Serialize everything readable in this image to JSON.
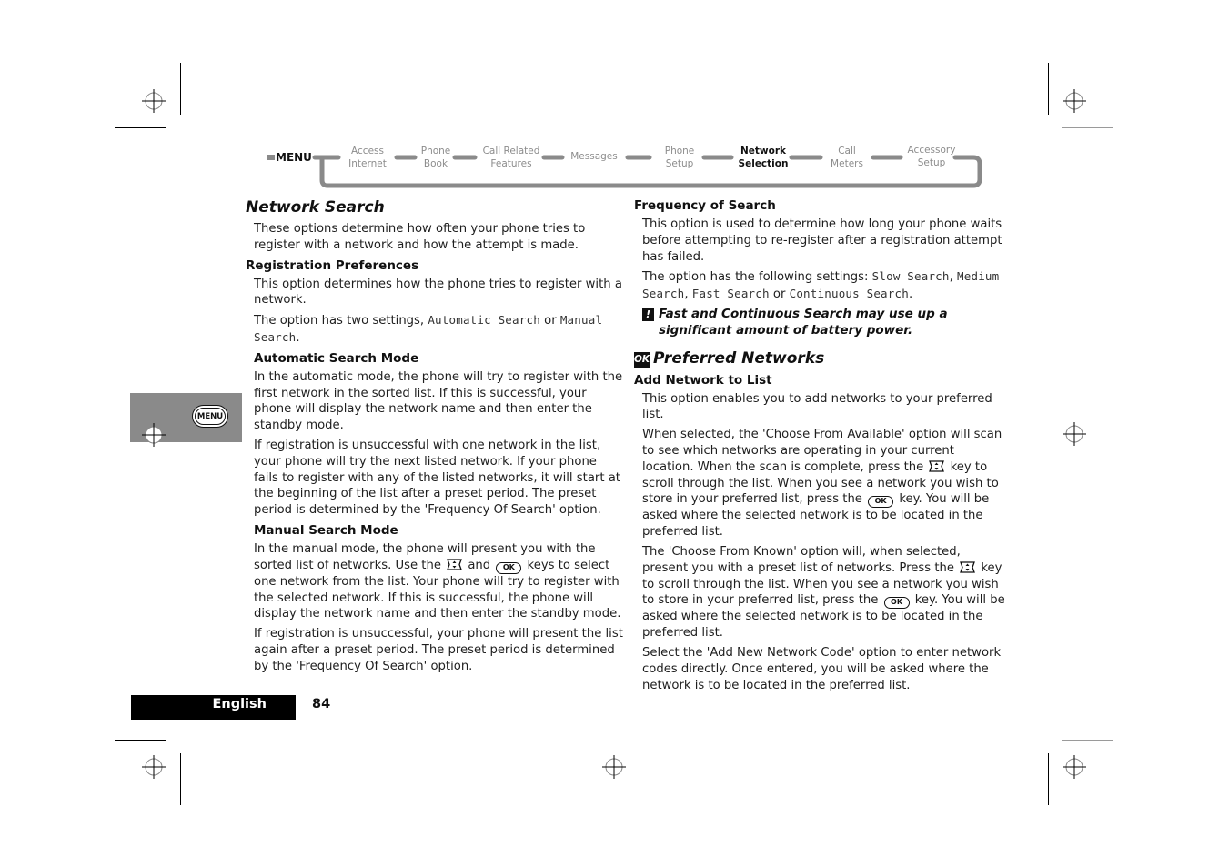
{
  "nav": {
    "menu_label": "MENU",
    "items": [
      {
        "line1": "Access",
        "line2": "Internet",
        "active": false
      },
      {
        "line1": "Phone",
        "line2": "Book",
        "active": false
      },
      {
        "line1": "Call Related",
        "line2": "Features",
        "active": false
      },
      {
        "line1": "Messages",
        "line2": "",
        "active": false
      },
      {
        "line1": "Phone",
        "line2": "Setup",
        "active": false
      },
      {
        "line1": "Network",
        "line2": "Selection",
        "active": true
      },
      {
        "line1": "Call",
        "line2": "Meters",
        "active": false
      },
      {
        "line1": "Accessory",
        "line2": "Setup",
        "active": false
      }
    ]
  },
  "side_tab": {
    "key_label": "MENU"
  },
  "left": {
    "title": "Network Search",
    "intro": "These options determine how often your phone tries to register with a network and how the attempt is made.",
    "reg_pref": {
      "heading": "Registration Preferences",
      "p1": "This option determines how the phone tries to register with a network.",
      "p2_prefix": "The option has two settings, ",
      "p2_setting1": "Automatic Search",
      "p2_mid": " or ",
      "p2_setting2": "Manual Search",
      "p2_suffix": "."
    },
    "auto_mode": {
      "heading": "Automatic Search Mode",
      "p1": "In the automatic mode, the phone will try to register with the first network in the sorted list. If this is successful, your phone will display the network name and then enter the standby mode.",
      "p2": "If registration is unsuccessful with one network in the list, your phone will try the next listed network. If your phone fails to register with any of the listed networks, it will start at the beginning of the list after a preset period. The preset period is determined by the 'Frequency Of Search' option."
    },
    "manual_mode": {
      "heading": "Manual Search Mode",
      "p1_a": "In the manual mode, the phone will present you with the sorted list of networks. Use the ",
      "p1_b": " and ",
      "p1_c": " keys to select one network from the list. Your phone will try to register with the selected network. If this is successful, the phone will display the network name and then enter the standby mode.",
      "p2": "If registration is unsuccessful, your phone will present the list again after a preset period. The preset period is determined by the 'Frequency Of Search' option."
    }
  },
  "right": {
    "freq": {
      "heading": "Frequency of Search",
      "p1": "This option is used to determine how long your phone waits before attempting to re-register after a registration attempt has failed.",
      "p2_prefix": "The option has the following settings: ",
      "settings": [
        "Slow Search",
        "Medium Search",
        "Fast Search",
        "Continuous Search"
      ],
      "sep1": ", ",
      "sep2": ", ",
      "sep3": " or ",
      "p2_suffix": ".",
      "note_icon": "!",
      "note": "Fast and Continuous Search may use up a significant amount of battery power."
    },
    "preferred": {
      "badge": "OK",
      "title": "Preferred Networks",
      "add": {
        "heading": "Add Network to List",
        "p1": "This option enables you to add networks to your preferred list.",
        "p2_a": "When selected, the 'Choose From Available' option will scan to see which networks are operating in your current location. When the scan is complete, press the ",
        "p2_b": " key to scroll through the list. When you see a network you wish to store in your preferred list, press the ",
        "p2_c": " key. You will be asked where the selected network is to be located in the preferred list.",
        "p3_a": "The 'Choose From Known' option will, when selected, present you with a preset list of networks. Press the ",
        "p3_b": " key to scroll through the list. When you see a network you wish to store in your preferred list, press the ",
        "p3_c": " key. You will be asked where the selected network is to be located in the preferred list.",
        "p4": "Select the 'Add New Network Code' option to enter network codes directly. Once entered, you will be asked where the network is to be located in the preferred list."
      }
    }
  },
  "keys": {
    "ok": "OK",
    "scroll_icon": "scroll-key-icon"
  },
  "footer": {
    "language": "English",
    "page": "84"
  },
  "colors": {
    "nav_track": "#8a8a8a",
    "nav_inactive_text": "#8c8c8c",
    "side_tab": "#8a8a8a",
    "footer_bar": "#000000"
  }
}
